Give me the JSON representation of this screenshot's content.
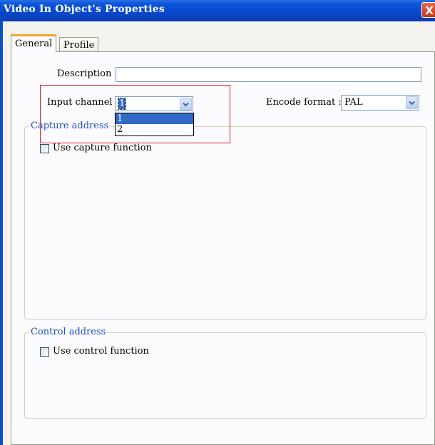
{
  "window": {
    "title": "Video In Object's Properties",
    "close_label": "X"
  },
  "tabs": [
    {
      "label": "General",
      "active": true
    },
    {
      "label": "Profile",
      "active": false
    }
  ],
  "general": {
    "description_label": "Description :",
    "description_value": "",
    "input_channel_label": "Input channel :",
    "input_channel_value": "1",
    "input_channel_options": [
      "1",
      "2"
    ],
    "encode_format_label": "Encode format :",
    "encode_format_value": "PAL"
  },
  "capture_group": {
    "legend": "Capture address",
    "checkbox_label": "Use capture function",
    "checked": false
  },
  "control_group": {
    "legend": "Control address",
    "checkbox_label": "Use control function",
    "checked": false
  },
  "colors": {
    "highlight": "#e02020",
    "titlebar": "#0a53d8",
    "selection": "#316ac5"
  }
}
